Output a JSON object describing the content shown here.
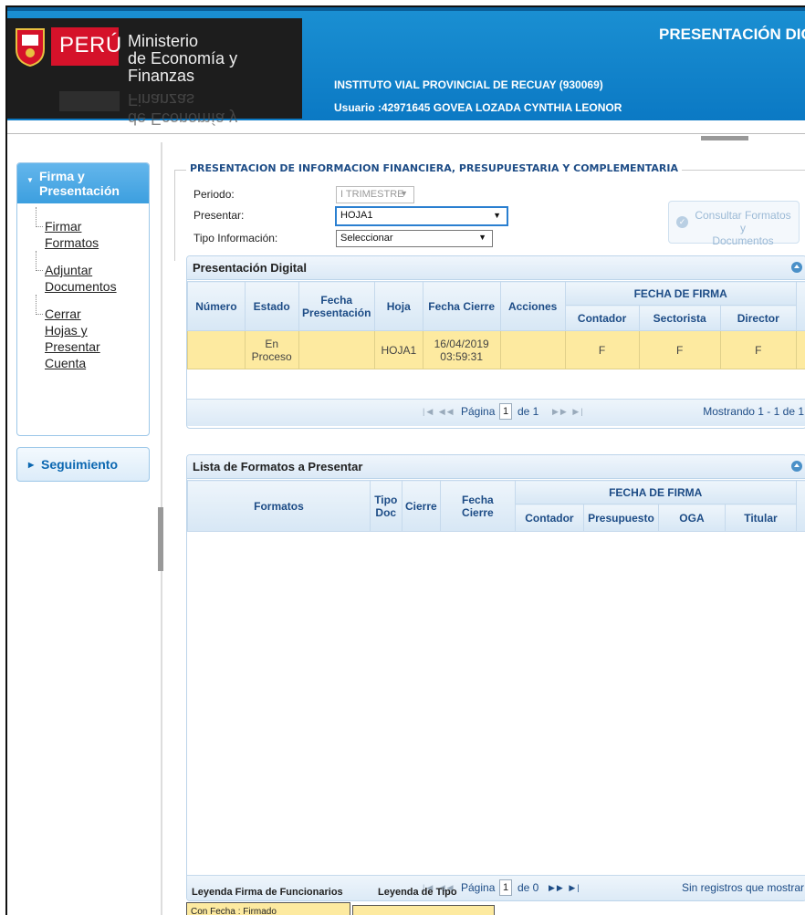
{
  "header": {
    "country": "PERÚ",
    "ministry_line1": "Ministerio",
    "ministry_line2": "de Economía y Finanzas",
    "ministry_reflection": "de Economía y Finanzas",
    "app_title": "PRESENTACIÓN DIGITA",
    "institution": "INSTITUTO VIAL PROVINCIAL DE RECUAY (930069)",
    "user": "Usuario :42971645 GOVEA LOZADA CYNTHIA LEONOR"
  },
  "sidebar": {
    "section1": {
      "title_line1": "Firma y",
      "title_line2": "Presentación",
      "items": [
        {
          "label_line1": "Firmar",
          "label_line2": "Formatos"
        },
        {
          "label_line1": "Adjuntar",
          "label_line2": "Documentos"
        },
        {
          "label_line1": "Cerrar",
          "label_line2": "Hojas y",
          "label_line3": "Presentar",
          "label_line4": "Cuenta"
        }
      ]
    },
    "section2": {
      "title": "Seguimiento"
    }
  },
  "form": {
    "legend": "PRESENTACION DE INFORMACION FINANCIERA, PRESUPUESTARIA Y COMPLEMENTARIA",
    "periodo_label": "Periodo:",
    "periodo_value": "I TRIMESTRE",
    "presentar_label": "Presentar:",
    "presentar_value": "HOJA1",
    "tipo_label": "Tipo Información:",
    "tipo_value": "Seleccionar",
    "consult_line1": "Consultar Formatos y",
    "consult_line2": "Documentos"
  },
  "panel1": {
    "title": "Presentación Digital",
    "headers": {
      "numero": "Número",
      "estado": "Estado",
      "fecha_pres_1": "Fecha",
      "fecha_pres_2": "Presentación",
      "hoja": "Hoja",
      "fecha_cierre": "Fecha Cierre",
      "acciones": "Acciones",
      "group": "FECHA DE FIRMA",
      "contador": "Contador",
      "sectorista": "Sectorista",
      "director": "Director"
    },
    "row": {
      "numero": "",
      "estado_1": "En",
      "estado_2": "Proceso",
      "fecha_pres": "",
      "hoja": "HOJA1",
      "fecha_cierre_1": "16/04/2019",
      "fecha_cierre_2": "03:59:31",
      "acciones": "",
      "contador": "F",
      "sectorista": "F",
      "director": "F"
    },
    "pager": {
      "pagina": "Página",
      "page": "1",
      "de": "de 1",
      "summary": "Mostrando 1 - 1 de 1"
    }
  },
  "panel2": {
    "title": "Lista de Formatos a Presentar",
    "headers": {
      "formatos": "Formatos",
      "tipo_1": "Tipo",
      "tipo_2": "Doc",
      "cierre": "Cierre",
      "fecha_1": "Fecha",
      "fecha_2": "Cierre",
      "group": "FECHA DE FIRMA",
      "contador": "Contador",
      "presupuesto": "Presupuesto",
      "oga": "OGA",
      "titular": "Titular"
    },
    "pager": {
      "pagina": "Página",
      "page": "1",
      "de": "de 0",
      "summary": "Sin registros que mostrar"
    }
  },
  "legend": {
    "firma_title": "Leyenda Firma de Funcionarios",
    "tipo_title": "Leyenda de Tipo",
    "firma_item": "Con Fecha : Firmado"
  },
  "colors": {
    "header_blue": "#1a8fd2",
    "row_yellow": "#fdeaa0",
    "accent_red": "#d5122a"
  }
}
